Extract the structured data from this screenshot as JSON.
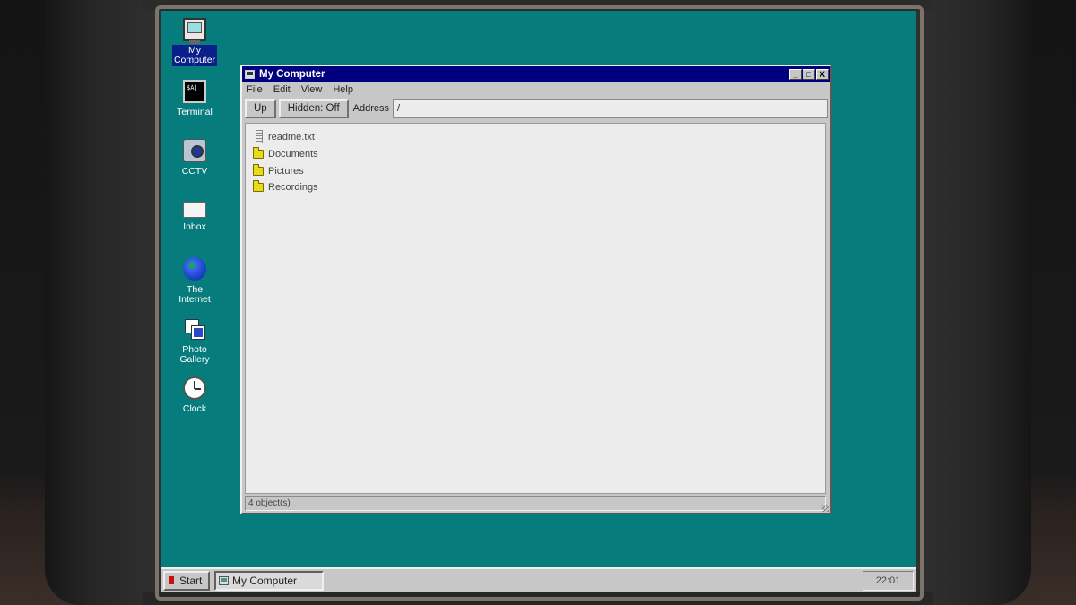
{
  "desktop": {
    "background_color": "#077c7c",
    "icons": [
      {
        "label": "My\nComputer",
        "label_line1": "My",
        "label_line2": "Computer",
        "icon": "my-computer-icon",
        "selected": true
      },
      {
        "label": "Terminal",
        "icon": "terminal-icon"
      },
      {
        "label": "CCTV",
        "icon": "camera-icon"
      },
      {
        "label": "Inbox",
        "icon": "mail-icon"
      },
      {
        "label": "The Internet",
        "icon": "globe-icon"
      },
      {
        "label_line1": "Photo",
        "label_line2": "Gallery",
        "icon": "photo-gallery-icon"
      },
      {
        "label": "Clock",
        "icon": "clock-icon"
      }
    ],
    "terminal_glyph_text": "$A|_"
  },
  "window": {
    "title": "My Computer",
    "titlebar_color": "#00007f",
    "controls": {
      "minimize": "_",
      "maximize": "□",
      "close": "X"
    },
    "menu": [
      "File",
      "Edit",
      "View",
      "Help"
    ],
    "toolbar": {
      "up_label": "Up",
      "hidden_label": "Hidden: Off",
      "address_label": "Address",
      "address_value": "/"
    },
    "files": [
      {
        "name": "readme.txt",
        "type": "file",
        "icon": "text-file-icon"
      },
      {
        "name": "Documents",
        "type": "folder",
        "icon": "folder-icon"
      },
      {
        "name": "Pictures",
        "type": "folder",
        "icon": "folder-icon"
      },
      {
        "name": "Recordings",
        "type": "folder",
        "icon": "folder-icon"
      }
    ],
    "status": "4 object(s)"
  },
  "taskbar": {
    "start_label": "Start",
    "task_label": "My Computer",
    "time": "22:01"
  }
}
